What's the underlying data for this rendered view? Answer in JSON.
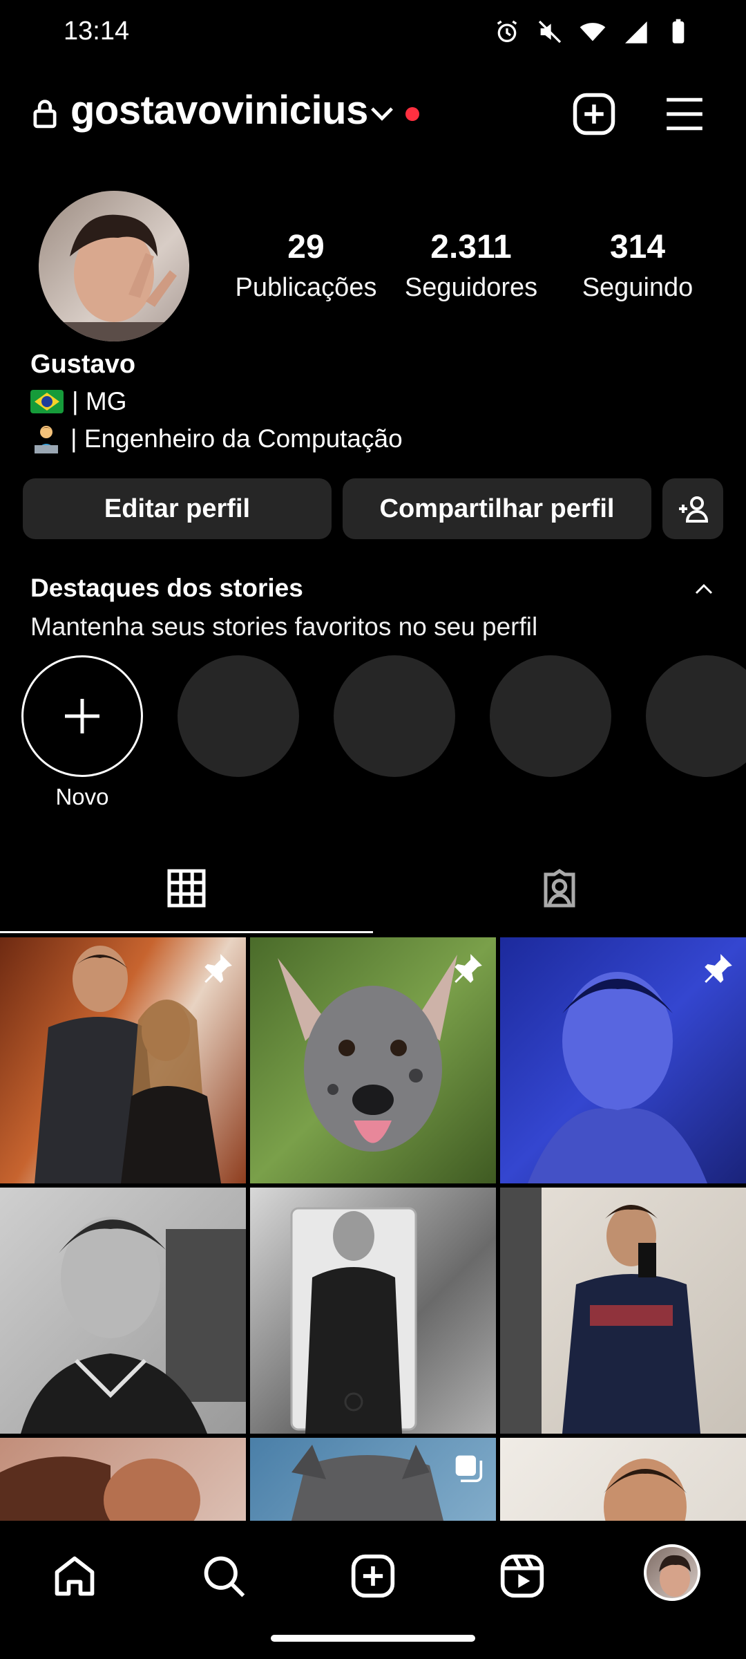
{
  "status_bar": {
    "time": "13:14"
  },
  "header": {
    "username": "gostavovinicius"
  },
  "stats": [
    {
      "value": "29",
      "label": "Publicações"
    },
    {
      "value": "2.311",
      "label": "Seguidores"
    },
    {
      "value": "314",
      "label": "Seguindo"
    }
  ],
  "bio": {
    "name": "Gustavo",
    "line1": "| MG",
    "line2": "| Engenheiro da Computação"
  },
  "buttons": {
    "edit": "Editar perfil",
    "share": "Compartilhar perfil"
  },
  "highlights": {
    "title": "Destaques dos stories",
    "subtitle": "Mantenha seus stories favoritos no seu perfil",
    "new_label": "Novo"
  },
  "colors": {
    "accent_red": "#ff3040",
    "button_bg": "#262626"
  }
}
